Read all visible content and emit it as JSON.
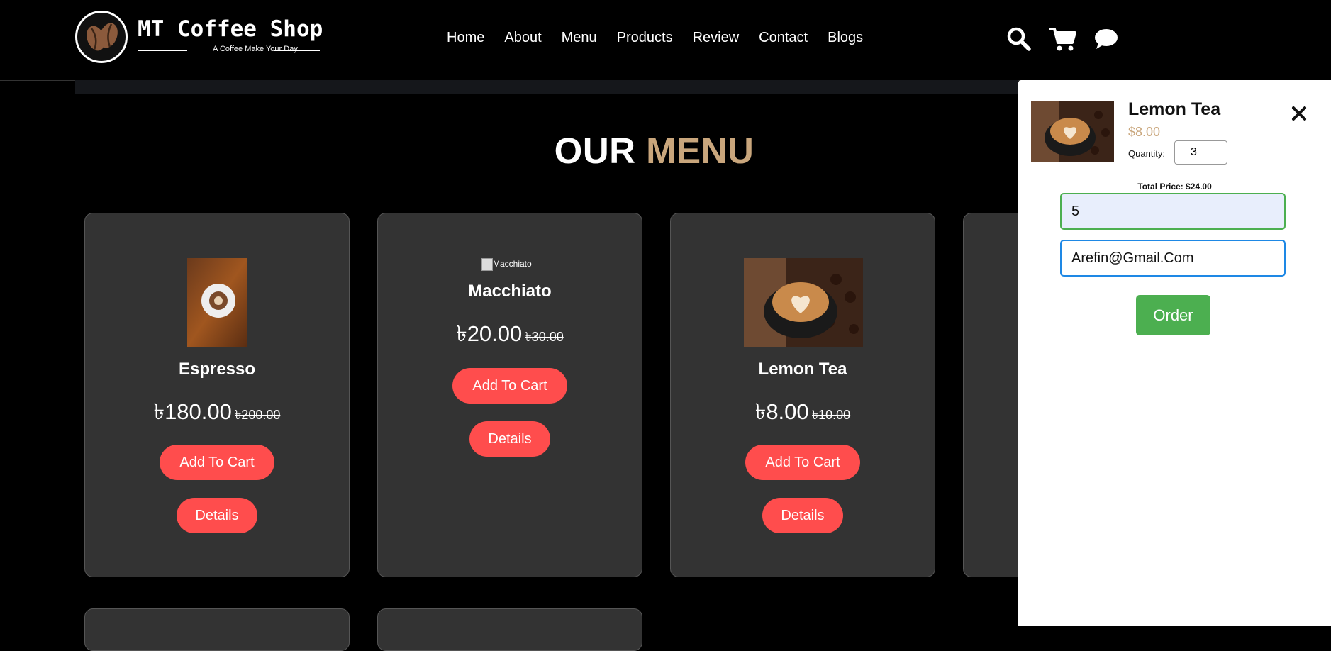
{
  "brand": {
    "title": "MT Coffee Shop",
    "tagline": "A Coffee Make Your Day"
  },
  "nav": {
    "items": [
      "Home",
      "About",
      "Menu",
      "Products",
      "Review",
      "Contact",
      "Blogs"
    ]
  },
  "header_icons": [
    "search-icon",
    "cart-icon",
    "chat-icon"
  ],
  "menu": {
    "heading_part1": "OUR",
    "heading_part2": "MENU",
    "cards": [
      {
        "name": "Espresso",
        "price": "৳180.00",
        "old_price": "৳200.00",
        "image_alt": "",
        "add_label": "Add To Cart",
        "details_label": "Details"
      },
      {
        "name": "Macchiato",
        "price": "৳20.00",
        "old_price": "৳30.00",
        "image_alt": "Macchiato",
        "add_label": "Add To Cart",
        "details_label": "Details"
      },
      {
        "name": "Lemon Tea",
        "price": "৳8.00",
        "old_price": "৳10.00",
        "image_alt": "",
        "add_label": "Add To Cart",
        "details_label": "Details"
      }
    ]
  },
  "cart": {
    "item_name": "Lemon Tea",
    "item_price": "$8.00",
    "quantity_label": "Quantity:",
    "quantity_value": "3",
    "total_label": "Total Price: $24.00",
    "phone_value": "5",
    "email_value": "Arefin@Gmail.Com",
    "order_label": "Order"
  },
  "colors": {
    "accent_gold": "#c9a67c",
    "button_red": "#ff4d4d",
    "order_green": "#4caf50",
    "card_bg": "#333333"
  }
}
